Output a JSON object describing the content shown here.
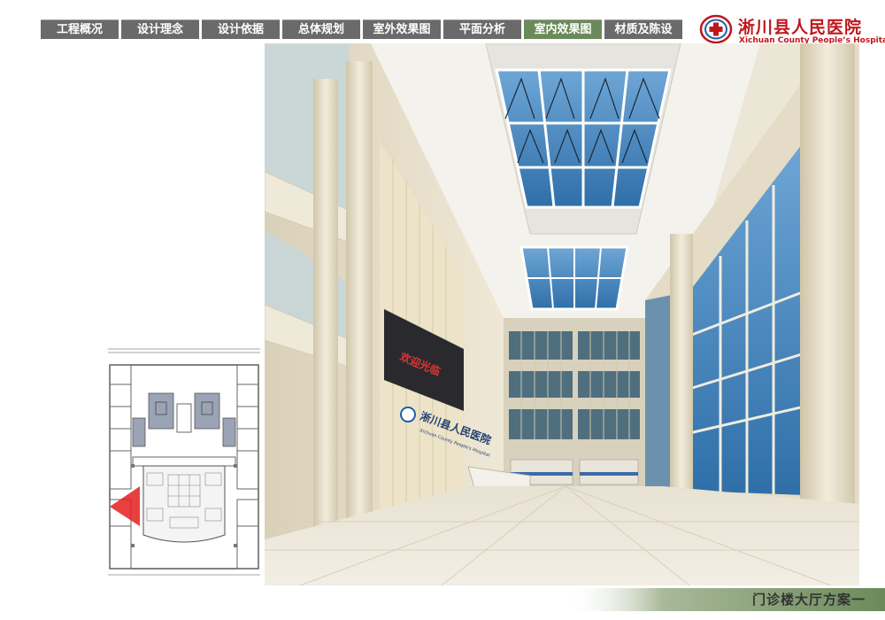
{
  "nav": {
    "items": [
      {
        "label": "工程概况",
        "active": false
      },
      {
        "label": "设计理念",
        "active": false
      },
      {
        "label": "设计依据",
        "active": false
      },
      {
        "label": "总体规划",
        "active": false
      },
      {
        "label": "室外效果图",
        "active": false
      },
      {
        "label": "平面分析",
        "active": false
      },
      {
        "label": "室内效果图",
        "active": true
      },
      {
        "label": "材质及陈设",
        "active": false
      }
    ]
  },
  "logo": {
    "name_cn": "淅川县人民医院",
    "name_en": "Xichuan County People’s Hospital"
  },
  "rendering": {
    "wall_sign_cn": "淅川县人民医院",
    "wall_sign_en": "Xichuan County People's Hospital",
    "led_screen_text": "欢迎光临"
  },
  "caption": "门诊楼大厅方案一",
  "colors": {
    "nav_bg": "#6a6a6a",
    "nav_active": "#6b8a5a",
    "brand_red": "#c0161b",
    "caption_green": "#6b8a5a"
  }
}
